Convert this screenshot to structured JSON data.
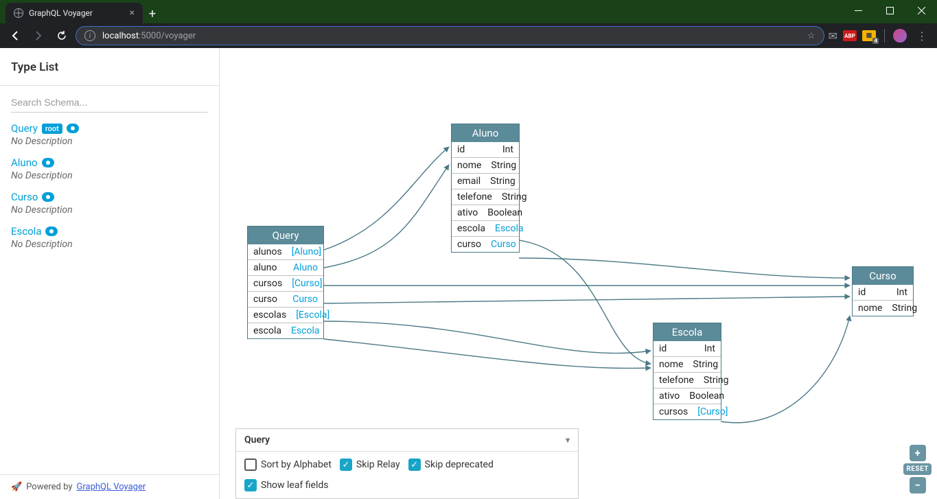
{
  "browser": {
    "tabTitle": "GraphQL Voyager",
    "urlHost": "localhost",
    "urlRest": ":5000/voyager",
    "extBadge": "4",
    "abp": "ABP"
  },
  "sidebar": {
    "title": "Type List",
    "searchPlaceholder": "Search Schema...",
    "rootBadge": "root",
    "noDescription": "No Description",
    "types": [
      {
        "name": "Query",
        "root": true
      },
      {
        "name": "Aluno",
        "root": false
      },
      {
        "name": "Curso",
        "root": false
      },
      {
        "name": "Escola",
        "root": false
      }
    ],
    "footerPrefix": "Powered by",
    "footerLink": "GraphQL Voyager"
  },
  "panel": {
    "title": "Query",
    "options": [
      {
        "label": "Sort by Alphabet",
        "checked": false
      },
      {
        "label": "Skip Relay",
        "checked": true
      },
      {
        "label": "Skip deprecated",
        "checked": true
      },
      {
        "label": "Show leaf fields",
        "checked": true
      }
    ]
  },
  "zoom": {
    "reset": "RESET"
  },
  "nodes": {
    "Query": {
      "title": "Query",
      "fields": [
        {
          "name": "alunos",
          "type": "[Aluno]",
          "link": true
        },
        {
          "name": "aluno",
          "type": "Aluno",
          "link": true
        },
        {
          "name": "cursos",
          "type": "[Curso]",
          "link": true
        },
        {
          "name": "curso",
          "type": "Curso",
          "link": true
        },
        {
          "name": "escolas",
          "type": "[Escola]",
          "link": true
        },
        {
          "name": "escola",
          "type": "Escola",
          "link": true
        }
      ]
    },
    "Aluno": {
      "title": "Aluno",
      "fields": [
        {
          "name": "id",
          "type": "Int",
          "link": false
        },
        {
          "name": "nome",
          "type": "String",
          "link": false
        },
        {
          "name": "email",
          "type": "String",
          "link": false
        },
        {
          "name": "telefone",
          "type": "String",
          "link": false
        },
        {
          "name": "ativo",
          "type": "Boolean",
          "link": false
        },
        {
          "name": "escola",
          "type": "Escola",
          "link": true
        },
        {
          "name": "curso",
          "type": "Curso",
          "link": true
        }
      ]
    },
    "Escola": {
      "title": "Escola",
      "fields": [
        {
          "name": "id",
          "type": "Int",
          "link": false
        },
        {
          "name": "nome",
          "type": "String",
          "link": false
        },
        {
          "name": "telefone",
          "type": "String",
          "link": false
        },
        {
          "name": "ativo",
          "type": "Boolean",
          "link": false
        },
        {
          "name": "cursos",
          "type": "[Curso]",
          "link": true
        }
      ]
    },
    "Curso": {
      "title": "Curso",
      "fields": [
        {
          "name": "id",
          "type": "Int",
          "link": false
        },
        {
          "name": "nome",
          "type": "String",
          "link": false
        }
      ]
    }
  }
}
